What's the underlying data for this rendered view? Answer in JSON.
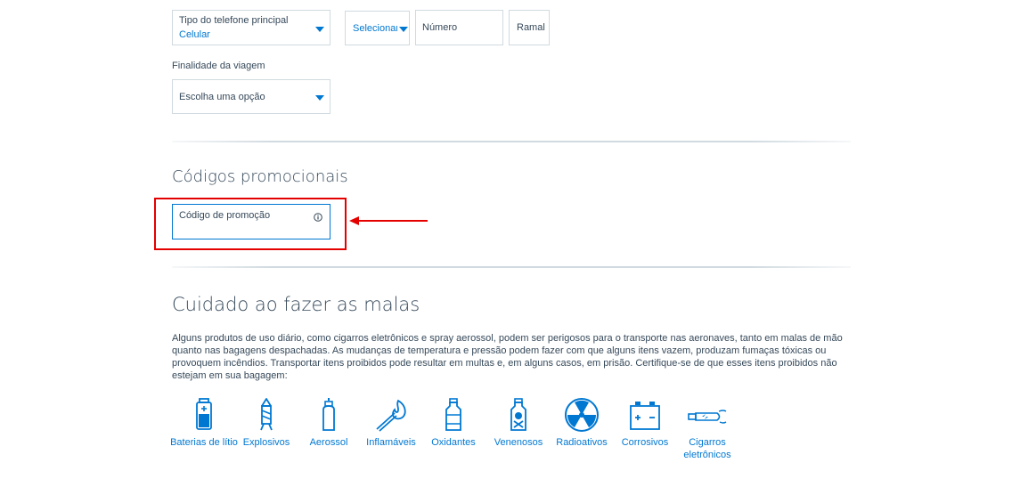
{
  "contact": {
    "phone_type_label": "Tipo do telefone principal",
    "phone_type_value": "Celular",
    "country_code_value": "Selecionar",
    "number_placeholder": "Número",
    "extension_placeholder": "Ramal",
    "trip_purpose_label": "Finalidade da viagem",
    "trip_purpose_value": "Escolha uma opção"
  },
  "promo": {
    "section_title": "Códigos promocionais",
    "field_label": "Código de promoção",
    "info_icon": "info-icon"
  },
  "packing": {
    "title": "Cuidado ao fazer as malas",
    "body": "Alguns produtos de uso diário, como cigarros eletrônicos e spray aerossol, podem ser perigosos para o transporte nas aeronaves, tanto em malas de mão quanto nas bagagens despachadas. As mudanças de temperatura e pressão podem fazer com que alguns itens vazem, produzam fumaças tóxicas ou provoquem incêndios. Transportar itens proibidos pode resultar em multas e, em alguns casos, em prisão. Certifique-se de que esses itens proibidos não estejam em sua bagagem:",
    "items": [
      {
        "label": "Baterias de lítio",
        "icon": "battery-icon"
      },
      {
        "label": "Explosivos",
        "icon": "firework-icon"
      },
      {
        "label": "Aerossol",
        "icon": "aerosol-can-icon"
      },
      {
        "label": "Inflamáveis",
        "icon": "match-flame-icon"
      },
      {
        "label": "Oxidantes",
        "icon": "bottle-icon"
      },
      {
        "label": "Venenosos",
        "icon": "poison-bottle-icon"
      },
      {
        "label": "Radioativos",
        "icon": "radiation-icon"
      },
      {
        "label": "Corrosivos",
        "icon": "car-battery-icon"
      },
      {
        "label": "Cigarros eletrônicos",
        "icon": "e-cigarette-icon"
      }
    ]
  },
  "colors": {
    "accent": "#0078d2",
    "text": "#36495a",
    "highlight": "#e50000"
  }
}
